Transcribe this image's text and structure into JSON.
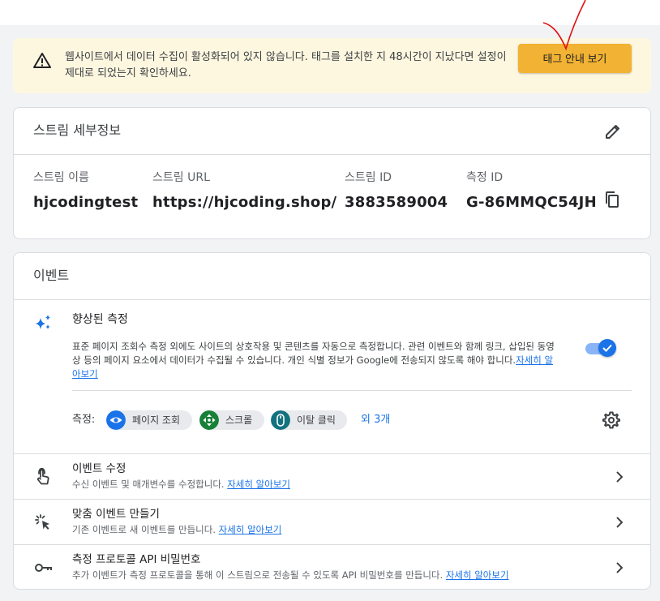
{
  "banner": {
    "message": "웹사이트에서 데이터 수집이 활성화되어 있지 않습니다. 태그를 설치한 지 48시간이 지났다면 설정이 제대로 되었는지 확인하세요.",
    "button_label": "태그 안내 보기",
    "icon": "warning-icon"
  },
  "stream_details": {
    "title": "스트림 세부정보",
    "fields": [
      {
        "label": "스트림 이름",
        "value": "hjcodingtest"
      },
      {
        "label": "스트림 URL",
        "value": "https://hjcoding.shop/"
      },
      {
        "label": "스트림 ID",
        "value": "3883589004"
      },
      {
        "label": "측정 ID",
        "value": "G-86MMQC54JH"
      }
    ],
    "edit_icon": "pencil-icon",
    "copy_icon": "copy-icon"
  },
  "events": {
    "title": "이벤트",
    "enhanced": {
      "title": "향상된 측정",
      "description": "표준 페이지 조회수 측정 외에도 사이트의 상호작용 및 콘텐츠를 자동으로 측정합니다. 관련 이벤트와 함께 링크, 삽입된 동영상 등의 페이지 요소에서 데이터가 수집될 수 있습니다. 개인 식별 정보가 Google에 전송되지 않도록 해야 합니다.",
      "learn_more": "자세히 알아보기",
      "enabled": true,
      "measure_label": "측정:",
      "chips": [
        {
          "label": "페이지 조회",
          "icon": "eye-icon",
          "color": "#1a73e8"
        },
        {
          "label": "스크롤",
          "icon": "scroll-arrows-icon",
          "color": "#188038"
        },
        {
          "label": "이탈 클릭",
          "icon": "mouse-icon",
          "color": "#12727e"
        }
      ],
      "more": "외 3개"
    },
    "rows": [
      {
        "title": "이벤트 수정",
        "desc": "수신 이벤트 및 매개변수를 수정합니다.",
        "link": "자세히 알아보기",
        "icon": "touch-icon"
      },
      {
        "title": "맞춤 이벤트 만들기",
        "desc": "기존 이벤트로 새 이벤트를 만듭니다.",
        "link": "자세히 알아보기",
        "icon": "click-sparkle-icon"
      },
      {
        "title": "측정 프로토콜 API 비밀번호",
        "desc": "추가 이벤트가 측정 프로토콜을 통해 이 스트림으로 전송될 수 있도록 API 비밀번호를 만듭니다.",
        "link": "자세히 알아보기",
        "icon": "key-icon"
      }
    ]
  },
  "colors": {
    "accent": "#1a73e8",
    "banner_bg": "#fef7e0",
    "banner_button": "#f2b233",
    "annotation": "#e01010"
  }
}
